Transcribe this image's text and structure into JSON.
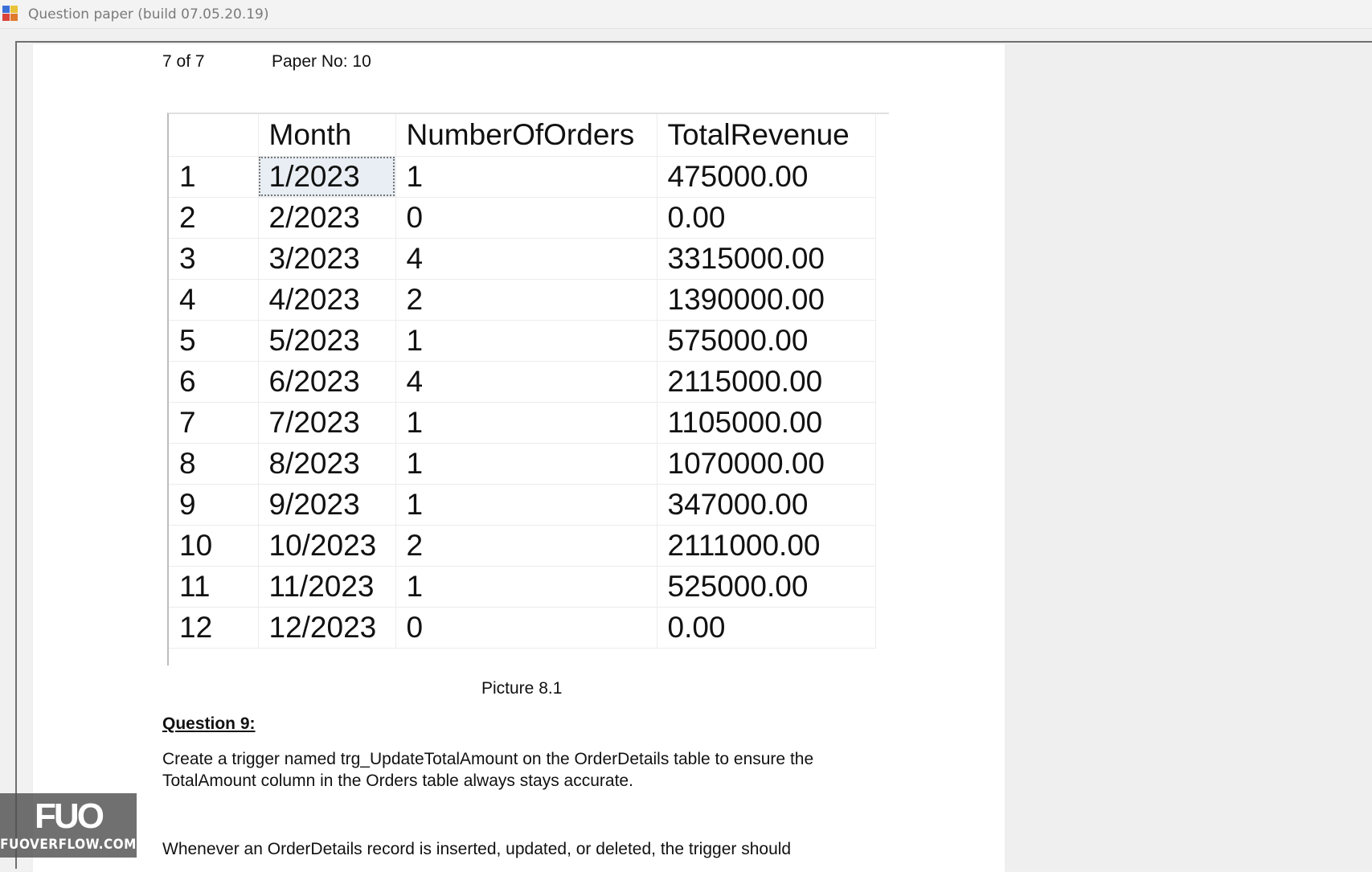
{
  "window": {
    "title": "Question paper (build 07.05.20.19)"
  },
  "paper": {
    "page_indicator": "7 of 7",
    "paper_no": "Paper No: 10"
  },
  "result_grid": {
    "columns": [
      "",
      "Month",
      "NumberOfOrders",
      "TotalRevenue"
    ],
    "rows": [
      [
        "1",
        "1/2023",
        "1",
        "475000.00"
      ],
      [
        "2",
        "2/2023",
        "0",
        "0.00"
      ],
      [
        "3",
        "3/2023",
        "4",
        "3315000.00"
      ],
      [
        "4",
        "4/2023",
        "2",
        "1390000.00"
      ],
      [
        "5",
        "5/2023",
        "1",
        "575000.00"
      ],
      [
        "6",
        "6/2023",
        "4",
        "2115000.00"
      ],
      [
        "7",
        "7/2023",
        "1",
        "1105000.00"
      ],
      [
        "8",
        "8/2023",
        "1",
        "1070000.00"
      ],
      [
        "9",
        "9/2023",
        "1",
        "347000.00"
      ],
      [
        "10",
        "10/2023",
        "2",
        "2111000.00"
      ],
      [
        "11",
        "11/2023",
        "1",
        "525000.00"
      ],
      [
        "12",
        "12/2023",
        "0",
        "0.00"
      ]
    ]
  },
  "caption": "Picture 8.1",
  "question": {
    "title": "Question 9:",
    "body": "Create a trigger named trg_UpdateTotalAmount on the OrderDetails table to ensure the TotalAmount column in the Orders table always stays accurate.",
    "body2": "Whenever an OrderDetails record is inserted, updated, or deleted, the trigger should"
  },
  "watermark": {
    "logo": "FUO",
    "text": "FUOVERFLOW.COM"
  },
  "colors": {
    "title_text": "#7a7a7a",
    "frame": "#6f6f6f",
    "selected_cell": "#e8eef4"
  }
}
